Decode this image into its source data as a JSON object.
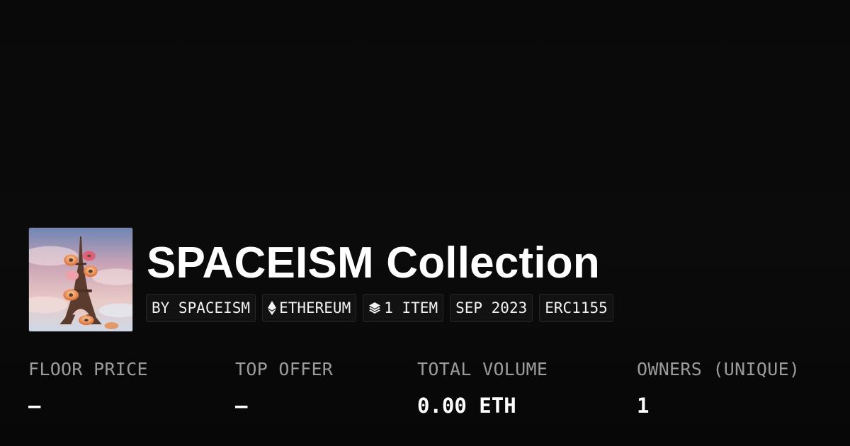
{
  "collection": {
    "title": "SPACEISM Collection",
    "thumbnail_icon": "collection-artwork-eiffel-tower-donuts"
  },
  "chips": {
    "creator": "BY SPACEISM",
    "chain": "ETHEREUM",
    "chain_icon": "ethereum-icon",
    "items": "1 ITEM",
    "items_icon": "layers-icon",
    "date": "SEP 2023",
    "standard": "ERC1155"
  },
  "stats": {
    "floor_price": {
      "label": "FLOOR PRICE",
      "value": "–"
    },
    "top_offer": {
      "label": "TOP OFFER",
      "value": "–"
    },
    "total_volume": {
      "label": "TOTAL VOLUME",
      "value": "0.00 ETH"
    },
    "owners": {
      "label": "OWNERS (UNIQUE)",
      "value": "1"
    }
  },
  "colors": {
    "background": "#0a0a0a",
    "chip_background": "#121212",
    "label": "#9b9b9b",
    "value": "#ffffff"
  }
}
